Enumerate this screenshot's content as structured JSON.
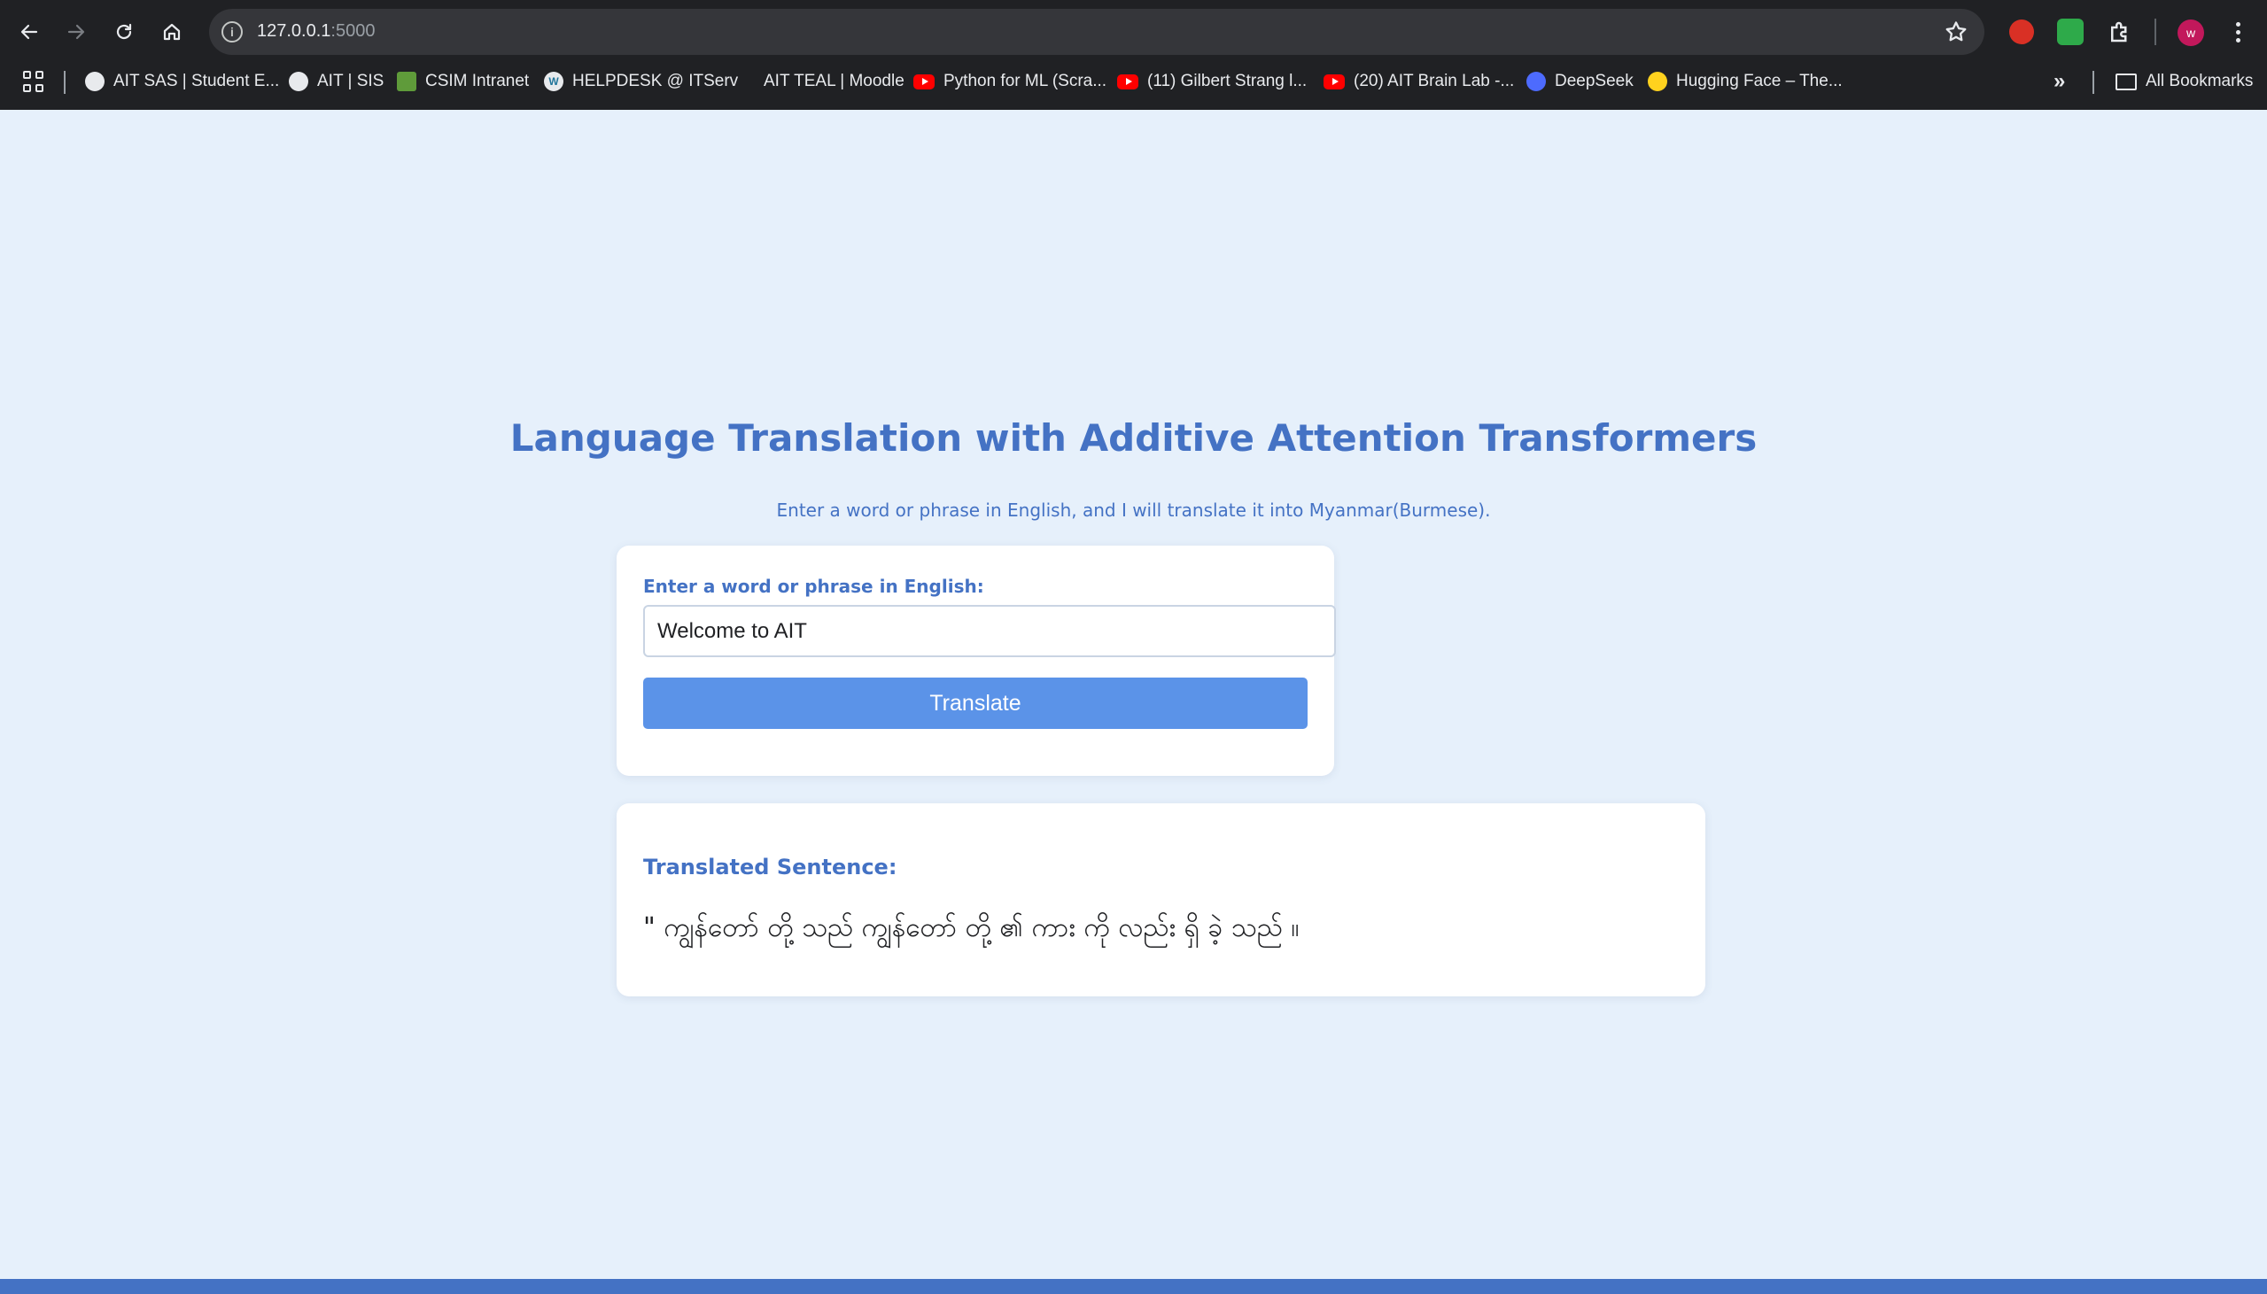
{
  "browser": {
    "url_host": "127.0.0.1",
    "url_port": ":5000",
    "profile_initial": "w",
    "bookmarks": [
      {
        "label": "AIT SAS | Student E...",
        "icon": "globe-icon"
      },
      {
        "label": "AIT | SIS",
        "icon": "globe-icon"
      },
      {
        "label": "CSIM Intranet",
        "icon": "csim-icon"
      },
      {
        "label": "HELPDESK @ ITServ",
        "icon": "wordpress-icon"
      },
      {
        "label": "AIT TEAL | Moodle",
        "icon": ""
      },
      {
        "label": "Python for ML (Scra...",
        "icon": "youtube-icon"
      },
      {
        "label": "(11) Gilbert Strang l...",
        "icon": "youtube-icon"
      },
      {
        "label": "(20) AIT Brain Lab -...",
        "icon": "youtube-icon"
      },
      {
        "label": "DeepSeek",
        "icon": "deepseek-icon"
      },
      {
        "label": "Hugging Face – The...",
        "icon": "huggingface-icon"
      }
    ],
    "all_bookmarks_label": "All Bookmarks"
  },
  "page": {
    "title": "Language Translation with Additive Attention Transformers",
    "subtitle": "Enter a word or phrase in English, and I will translate it into Myanmar(Burmese).",
    "input_label": "Enter a word or phrase in English:",
    "input_value": "Welcome to AIT",
    "button_label": "Translate",
    "result_heading": "Translated Sentence:",
    "result_text": "\" ကျွန်တော် တို့ သည် ကျွန်တော် တို့ ၏ ကား ကို လည်း ရှိ ခဲ့ သည် ။"
  },
  "colors": {
    "page_bg": "#e6f0fb",
    "accent": "#4472c4",
    "button": "#5b93e8",
    "chrome_bg": "#202124"
  }
}
